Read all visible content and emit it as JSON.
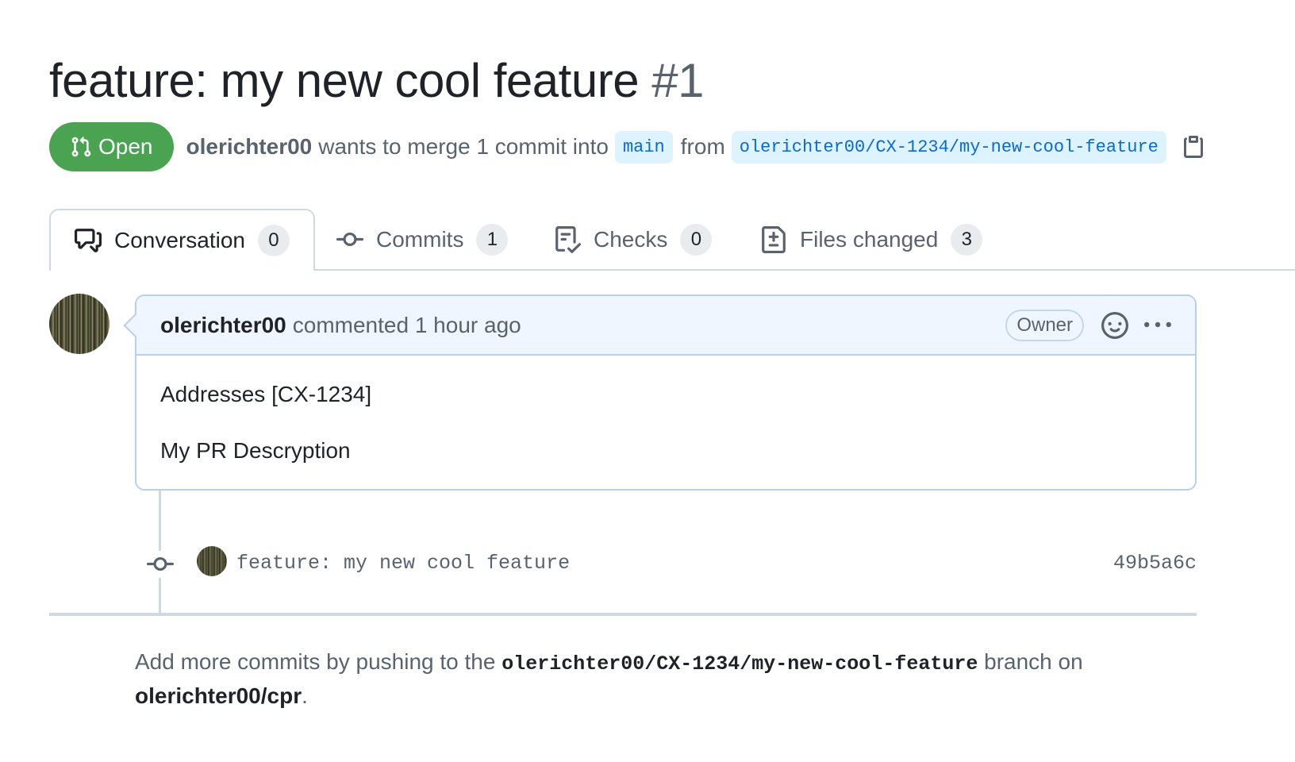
{
  "pr": {
    "title": "feature: my new cool feature",
    "number": "#1",
    "state": "Open",
    "author": "olerichter00",
    "merge_text_1": "wants to merge 1 commit into",
    "base_branch": "main",
    "merge_text_2": "from",
    "head_branch": "olerichter00/CX-1234/my-new-cool-feature"
  },
  "tabs": [
    {
      "label": "Conversation",
      "count": "0",
      "icon": "comment-discussion-icon"
    },
    {
      "label": "Commits",
      "count": "1",
      "icon": "git-commit-icon"
    },
    {
      "label": "Checks",
      "count": "0",
      "icon": "checklist-icon"
    },
    {
      "label": "Files changed",
      "count": "3",
      "icon": "file-diff-icon"
    }
  ],
  "comment": {
    "author": "olerichter00",
    "action": "commented 1 hour ago",
    "badge": "Owner",
    "body": [
      "Addresses [CX-1234]",
      "My PR Descryption"
    ]
  },
  "commit": {
    "message": "feature: my new cool feature",
    "sha": "49b5a6c"
  },
  "hint": {
    "text_1": "Add more commits by pushing to the",
    "branch": "olerichter00/CX-1234/my-new-cool-feature",
    "text_2": "branch on",
    "repo": "olerichter00/cpr",
    "end": "."
  },
  "colors": {
    "open_green": "#4aa351",
    "link_blue": "#0969da",
    "comment_header_bg": "#f0f6ff",
    "comment_border": "#b6cff2"
  }
}
